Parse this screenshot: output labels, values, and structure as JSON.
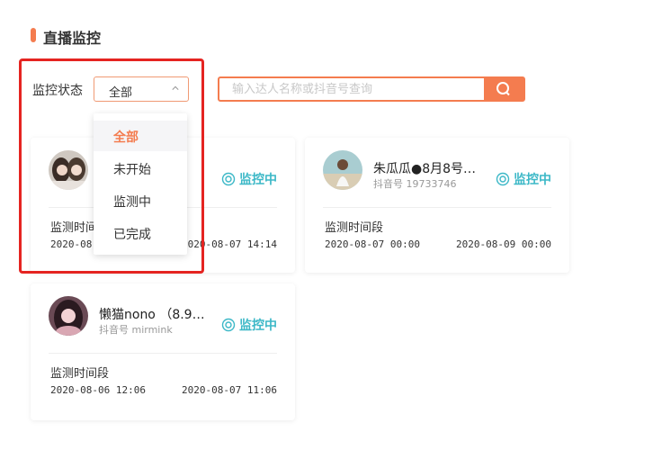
{
  "section": {
    "title": "直播监控"
  },
  "filter": {
    "label": "监控状态",
    "selected": "全部"
  },
  "search": {
    "placeholder": "输入达人名称或抖音号查询"
  },
  "dropdown": {
    "options": [
      "全部",
      "未开始",
      "监测中",
      "已完成"
    ]
  },
  "cards": [
    {
      "name": "",
      "handle": "",
      "status": "监控中",
      "period_label": "监测时间段",
      "start": "2020-08-",
      "end": "2020-08-07 14:14"
    },
    {
      "name": "朱瓜瓜●8月8号…",
      "handle": "抖音号 19733746",
      "status": "监控中",
      "period_label": "监测时间段",
      "start": "2020-08-07 00:00",
      "end": "2020-08-09 00:00"
    },
    {
      "name": "懒猫nono （8.9…",
      "handle": "抖音号 mirmink",
      "status": "监控中",
      "period_label": "监测时间段",
      "start": "2020-08-06 12:06",
      "end": "2020-08-07 11:06"
    }
  ],
  "colors": {
    "accent": "#f47c4f",
    "status": "#3cb8c7",
    "highlight": "#e52421"
  }
}
